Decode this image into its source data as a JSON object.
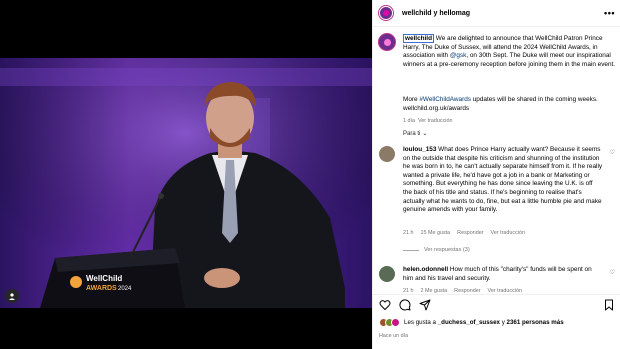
{
  "post": {
    "account": "wellchild y hellomag",
    "more": "•••",
    "caption_user": "wellchild",
    "caption_body_1": " We are delighted to announce that WellChild Patron Prince Harry, The Duke of Sussex, will attend the 2024 WellChild Awards, in association with ",
    "caption_mention": "@gsk",
    "caption_body_2": ", on 30th Sept. The Duke will meet our inspirational winners at a pre-ceremony reception before joining them in the main event.",
    "caption_more_1": "More ",
    "caption_hashtag": "#WellChildAwards",
    "caption_more_2": " updates will be shared in the coming weeks. wellchild.org.uk/awards",
    "age": "1 día",
    "translation": "Ver traducción",
    "para_ti": "Para ti",
    "chevron": "⌄",
    "likes_prefix": "Les gusta a ",
    "likes_user": "_duchess_of_sussex",
    "likes_conj": " y ",
    "likes_count": "2361 personas más",
    "posted": "Hace un día",
    "photo_lettering": "WellChild AWARDS",
    "photo_suffix": "2024"
  },
  "comments": [
    {
      "user": "loulou_153",
      "text": " What does Prince Harry actually want? Because it seems on the outside that despite his criticism and shunning of the institution he was born in to, he can't actually separate himself from it. If he really wanted a private life, he'd have got a job in a bank or Marketing or something. But everything he has done since leaving the U.K. is off the back of his title and status. If he's beginning to realise that's actually what he wants to do, fine, but eat a little humble pie and make genuine amends with your family.",
      "age": "21 h",
      "likes": "15 Me gusta",
      "reply": "Responder",
      "translation": "Ver traducción",
      "replies": "Ver respuestas (3)"
    },
    {
      "user": "helen.odonnell",
      "text": " How much of this \"charity's\" funds will be spent on him and his travel and security.",
      "age": "21 h",
      "likes": "2 Me gusta",
      "reply": "Responder",
      "translation": "Ver traducción"
    }
  ],
  "icons": {
    "heart": "♡",
    "comment": "comment-icon",
    "share": "share-icon",
    "save": "bookmark-icon",
    "user_tag": "user-tag-icon"
  },
  "colors": {
    "stage_purple": "#5a2a9a",
    "link": "#00376b",
    "meta_gray": "#737373"
  }
}
